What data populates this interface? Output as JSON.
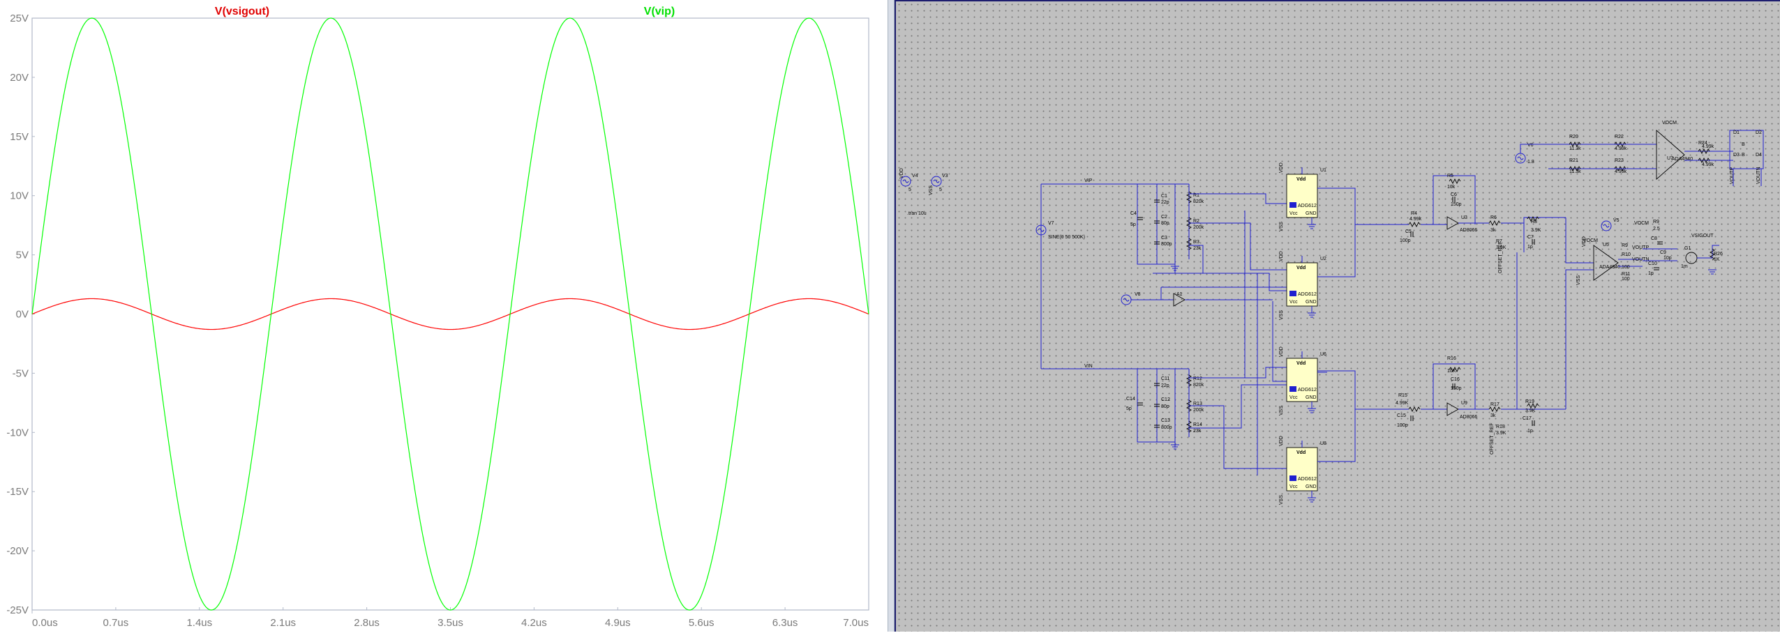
{
  "waveform": {
    "traces": [
      {
        "name": "V(vsigout)",
        "color": "#ff0000"
      },
      {
        "name": "V(vip)",
        "color": "#00ff00"
      }
    ],
    "y_ticks": [
      "25V",
      "20V",
      "15V",
      "10V",
      "5V",
      "0V",
      "-5V",
      "-10V",
      "-15V",
      "-20V",
      "-25V"
    ],
    "x_ticks": [
      "0.0us",
      "0.7us",
      "1.4us",
      "2.1us",
      "2.8us",
      "3.5us",
      "4.2us",
      "4.9us",
      "5.6us",
      "6.3us",
      "7.0us"
    ]
  },
  "chart_data": {
    "type": "line",
    "title": "",
    "xlabel": "",
    "ylabel": "",
    "xlim": [
      0,
      7.0
    ],
    "ylim": [
      -25,
      25
    ],
    "x_unit": "us",
    "y_unit": "V",
    "grid": false,
    "legend": "top",
    "series": [
      {
        "name": "V(vsigout)",
        "color": "#ff0000",
        "shape": "sine",
        "amplitude": 1.3,
        "frequency_mhz": 0.5,
        "phase_deg": 0
      },
      {
        "name": "V(vip)",
        "color": "#00ff00",
        "shape": "sine",
        "amplitude": 25,
        "frequency_mhz": 0.5,
        "phase_deg": 0
      }
    ]
  },
  "schematic": {
    "sources": {
      "v4": "V4",
      "v3": "V3",
      "v4_val": "5",
      "v3_val": "5",
      "v7": "V7",
      "v7_val": "SINE(0 50 500K)",
      "tran": ".tran 10u",
      "v6": "V6",
      "v6_val": "1.8",
      "v8": "V8",
      "v5": "V5",
      "v5_val": "2.5"
    },
    "nets": {
      "vip": "VIP",
      "vin": "VIN",
      "vdd": "VDD",
      "vss": "VSS",
      "vocm": "VOCM",
      "voutp": "VOUTP",
      "voutn": "VOUTN",
      "vsigout": "VSIGOUT",
      "offset_ref": "OFFSET_REF",
      "vdd_small": "Vdd",
      "gnd": "GND",
      "vcc": "Vcc"
    },
    "opamps": [
      {
        "ref": "U1",
        "model": "ADG612"
      },
      {
        "ref": "U2",
        "model": "ADG612"
      },
      {
        "ref": "U6",
        "model": "ADG612"
      },
      {
        "ref": "U8",
        "model": "ADG612"
      }
    ],
    "amps": [
      {
        "ref": "U3",
        "model": "AD8066"
      },
      {
        "ref": "U9",
        "model": "AD8066"
      },
      {
        "ref": "U5",
        "model": "ADA4940"
      },
      {
        "ref": "U7",
        "model": "ADA4940"
      }
    ],
    "top_bank": {
      "c1": "C1",
      "c1v": "22p",
      "c2": "C2",
      "c2v": "80p",
      "c3": "C3",
      "c3v": "800p",
      "c4": "C4",
      "c4v": "5p",
      "r1": "R1",
      "r1v": "820k",
      "r2": "R2",
      "r2v": "200k",
      "r3": "R3",
      "r3v": "23k"
    },
    "bot_bank": {
      "c11": "C11",
      "c11v": "22p",
      "c12": "C12",
      "c12v": "80p",
      "c13": "C13",
      "c13v": "800p",
      "c14": "C14",
      "c14v": "5p",
      "r12": "R12",
      "r12v": "820k",
      "r13": "R13",
      "r13v": "200k",
      "r14": "R14",
      "r14v": "23k"
    },
    "top_filter": {
      "r5": "R5",
      "r5v": "10k",
      "c6": "C6",
      "c6v": "150p",
      "r4": "R4",
      "r4v": "4.99k",
      "c5": "C5",
      "c5v": "100p",
      "r6": "R6",
      "r6v": "3k",
      "r7": "R7",
      "r7v": "3.9K",
      "r8": "R8",
      "r8v": "3.9K",
      "c7": "C7",
      "c7v": "1p"
    },
    "bot_filter": {
      "r16": "R16",
      "r16v": "10K",
      "c16": "C16",
      "c16v": "150p",
      "r15": "R15",
      "r15v": "4.99K",
      "c15": "C15",
      "c15v": "100p",
      "r17": "R17",
      "r17v": "3k",
      "r18": "R18",
      "r18v": "3.9K",
      "r19": "R19",
      "r19v": "3.9K",
      "c17": "C17",
      "c17v": "1p"
    },
    "output_stage": {
      "r9": "R9",
      "r9v": "2.5",
      "c8": "C8",
      "r10": "R10",
      "r10v": "100",
      "r11": "R11",
      "r11v": "100",
      "c10": "C10",
      "c10v": "1p",
      "c9": "C9",
      "c9v": "10p",
      "g1": "G1",
      "g1v": "1m",
      "r26": "R26",
      "r26v": "1K"
    },
    "ref_stage": {
      "r20": "R20",
      "r20v": "11.3k",
      "r21": "R21",
      "r21v": "11.3k",
      "r22": "R22",
      "r22v": "4.99k",
      "r23": "R23",
      "r23v": "4.99k",
      "r24": "R24",
      "r24v": "4.99k",
      "r25": "R25",
      "r25v": "4.99k",
      "d1": "D1",
      "d2": "D2",
      "d3": "D3",
      "d4": "D4",
      "b": "B"
    },
    "a1": "A1"
  }
}
